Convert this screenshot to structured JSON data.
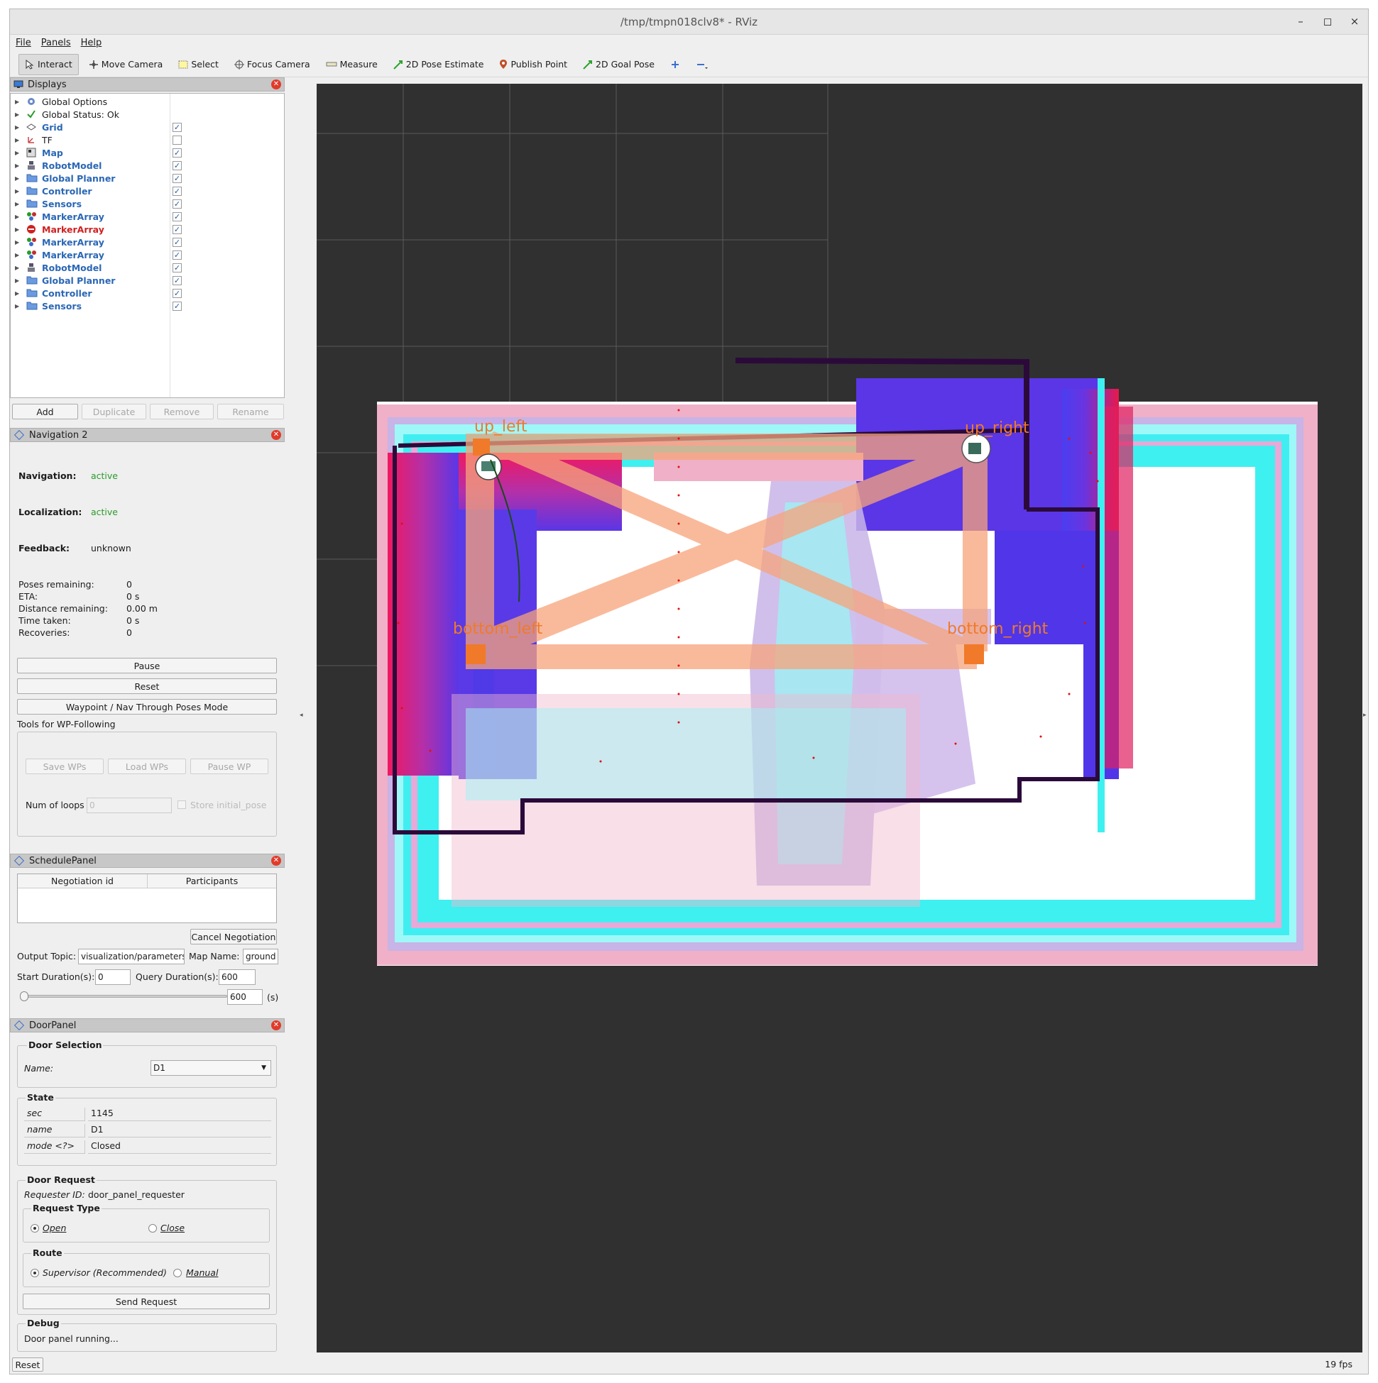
{
  "window": {
    "title": "/tmp/tmpn018clv8* - RViz",
    "controls": [
      "–",
      "◻",
      "×"
    ]
  },
  "menu": [
    "File",
    "Panels",
    "Help"
  ],
  "toolbar": {
    "interact": "Interact",
    "move_camera": "Move Camera",
    "select": "Select",
    "focus_camera": "Focus Camera",
    "measure": "Measure",
    "pose_estimate": "2D Pose Estimate",
    "publish_point": "Publish Point",
    "goal_pose": "2D Goal Pose"
  },
  "displays": {
    "title": "Displays",
    "items": [
      {
        "label": "Global Options",
        "style": "plain",
        "checked": null,
        "icon": "gear-icon"
      },
      {
        "label": "Global Status: Ok",
        "style": "plain",
        "checked": null,
        "icon": "check-icon"
      },
      {
        "label": "Grid",
        "style": "blue",
        "checked": true,
        "icon": "grid-icon"
      },
      {
        "label": "TF",
        "style": "plain",
        "checked": false,
        "icon": "tf-icon"
      },
      {
        "label": "Map",
        "style": "blue",
        "checked": true,
        "icon": "map-icon"
      },
      {
        "label": "RobotModel",
        "style": "blue",
        "checked": true,
        "icon": "robot-icon"
      },
      {
        "label": "Global Planner",
        "style": "blue",
        "checked": true,
        "icon": "folder-icon"
      },
      {
        "label": "Controller",
        "style": "blue",
        "checked": true,
        "icon": "folder-icon"
      },
      {
        "label": "Sensors",
        "style": "blue",
        "checked": true,
        "icon": "folder-icon"
      },
      {
        "label": "MarkerArray",
        "style": "blue",
        "checked": true,
        "icon": "marker-icon"
      },
      {
        "label": "MarkerArray",
        "style": "red",
        "checked": true,
        "icon": "error-icon"
      },
      {
        "label": "MarkerArray",
        "style": "blue",
        "checked": true,
        "icon": "marker-icon"
      },
      {
        "label": "MarkerArray",
        "style": "blue",
        "checked": true,
        "icon": "marker-icon"
      },
      {
        "label": "RobotModel",
        "style": "blue",
        "checked": true,
        "icon": "robot-icon"
      },
      {
        "label": "Global Planner",
        "style": "blue",
        "checked": true,
        "icon": "folder-icon"
      },
      {
        "label": "Controller",
        "style": "blue",
        "checked": true,
        "icon": "folder-icon"
      },
      {
        "label": "Sensors",
        "style": "blue",
        "checked": true,
        "icon": "folder-icon"
      }
    ],
    "buttons": {
      "add": "Add",
      "duplicate": "Duplicate",
      "remove": "Remove",
      "rename": "Rename"
    }
  },
  "navigation": {
    "title": "Navigation 2",
    "navigation_label": "Navigation:",
    "navigation_value": "active",
    "localization_label": "Localization:",
    "localization_value": "active",
    "feedback_label": "Feedback:",
    "feedback_value": "unknown",
    "stats": [
      {
        "label": "Poses remaining:",
        "value": "0"
      },
      {
        "label": "ETA:",
        "value": "0 s"
      },
      {
        "label": "Distance remaining:",
        "value": "0.00 m"
      },
      {
        "label": "Time taken:",
        "value": "0 s"
      },
      {
        "label": "Recoveries:",
        "value": "0"
      }
    ],
    "pause": "Pause",
    "reset": "Reset",
    "waypoint_mode": "Waypoint / Nav Through Poses Mode",
    "tools_label": "Tools for WP-Following",
    "save_wps": "Save WPs",
    "load_wps": "Load WPs",
    "pause_wp": "Pause WP",
    "num_loops_label": "Num of loops",
    "num_loops_value": "0",
    "store_initial_pose": "Store initial_pose"
  },
  "schedule": {
    "title": "SchedulePanel",
    "col_negotiation": "Negotiation id",
    "col_participants": "Participants",
    "cancel": "Cancel Negotiation",
    "output_topic_label": "Output Topic:",
    "output_topic_value": "visualization/parameters",
    "map_name_label": "Map Name:",
    "map_name_value": "ground",
    "start_label": "Start Duration(s):",
    "start_value": "0",
    "query_label": "Query Duration(s):",
    "query_value": "600",
    "slider_value": "600",
    "slider_unit": "(s)",
    "slider_position": 0.0
  },
  "door": {
    "title": "DoorPanel",
    "selection_title": "Door Selection",
    "name_label": "Name:",
    "name_value": "D1",
    "state_title": "State",
    "state_rows": [
      {
        "key": "sec",
        "value": "1145"
      },
      {
        "key": "name",
        "value": "D1"
      },
      {
        "key": "mode <?>",
        "value": "Closed"
      }
    ],
    "request_title": "Door Request",
    "requester_label": "Requester ID:",
    "requester_value": "door_panel_requester",
    "request_type_title": "Request Type",
    "open": "Open",
    "close": "Close",
    "route_title": "Route",
    "supervisor": "Supervisor (Recommended)",
    "manual": "Manual",
    "send": "Send Request",
    "debug_title": "Debug",
    "debug_text": "Door panel running..."
  },
  "viewport": {
    "labels": {
      "up_left": "up_left",
      "up_right": "up_right",
      "bottom_left": "bottom_left",
      "bottom_right": "bottom_right"
    },
    "colors": {
      "background": "#303030",
      "waypoint": "#f07a2a",
      "route": "#f8b48a",
      "inflation_cyan": "#3ff0f0",
      "inflation_blue": "#5a36e6",
      "wall": "#2b0a3a",
      "path_dots": "#e01010"
    }
  },
  "status": {
    "reset": "Reset",
    "fps": "19 fps"
  }
}
